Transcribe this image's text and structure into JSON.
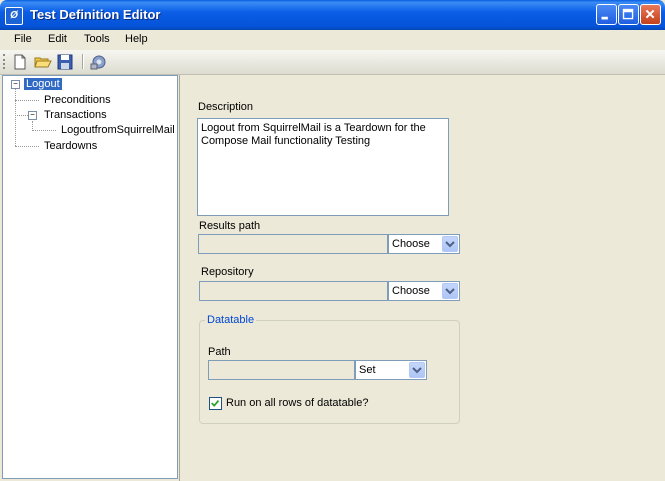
{
  "window": {
    "title": "Test Definition Editor",
    "icon": "app-icon"
  },
  "menu": [
    "File",
    "Edit",
    "Tools",
    "Help"
  ],
  "toolbar": {
    "icons": [
      "new-icon",
      "open-icon",
      "save-icon",
      "settings-icon"
    ]
  },
  "tree": {
    "root": "Logout",
    "preconditions": "Preconditions",
    "transactions": "Transactions",
    "transaction_child": "LogoutfromSquirrelMail",
    "teardowns": "Teardowns"
  },
  "form": {
    "description_label": "Description",
    "description_value": "Logout from SquirrelMail is a Teardown for the Compose Mail functionality Testing",
    "results_path_label": "Results path",
    "results_path_value": "",
    "results_path_button": "Choose",
    "repository_label": "Repository",
    "repository_value": "",
    "repository_button": "Choose",
    "datatable_group": "Datatable",
    "path_label": "Path",
    "path_value": "",
    "path_button": "Set",
    "run_all_rows_label": "Run on all rows of datatable?",
    "run_all_rows_checked": true
  },
  "colors": {
    "titlebar": "#0553d8",
    "selection": "#316ac5",
    "group_title": "#0046d5"
  }
}
